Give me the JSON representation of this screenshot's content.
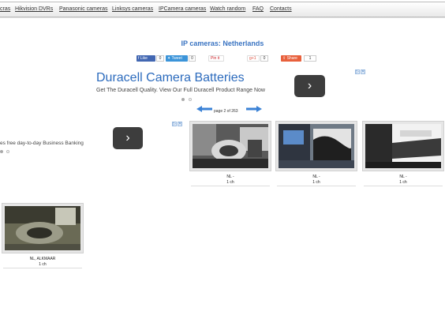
{
  "nav": {
    "items": [
      "cras",
      "Hikvision DVRs",
      "Panasonic cameras",
      "Linksys cameras",
      "IPCamera cameras",
      "Watch random",
      "FAQ",
      "Contacts"
    ]
  },
  "page_title": "IP cameras: Netherlands",
  "social": {
    "like_label": "Like",
    "like_count": "0",
    "tweet_label": "Tweet",
    "tweet_count": "0",
    "pin_label": "Pin it",
    "gplus_label": "+1",
    "gplus_count": "0",
    "share_label": "Share",
    "share_count": "1"
  },
  "ad_main": {
    "headline": "Duracell Camera Batteries",
    "text": "Get The Duracell Quality. View Our Full Duracell Product Range Now"
  },
  "ad_left": {
    "text": "es free day-to-day Business Banking"
  },
  "pager": {
    "text": "page 2 of 263"
  },
  "cameras": [
    {
      "name": "NL -",
      "channels": "1 ch"
    },
    {
      "name": "NL -",
      "channels": "1 ch"
    },
    {
      "name": "NL -",
      "channels": "1 ch"
    },
    {
      "name": "NL, ALKMAAR",
      "channels": "1 ch"
    }
  ],
  "colors": {
    "accent": "#3a74c2",
    "ad_link": "#2c6bbd",
    "pager_arrow": "#3b82d6"
  }
}
